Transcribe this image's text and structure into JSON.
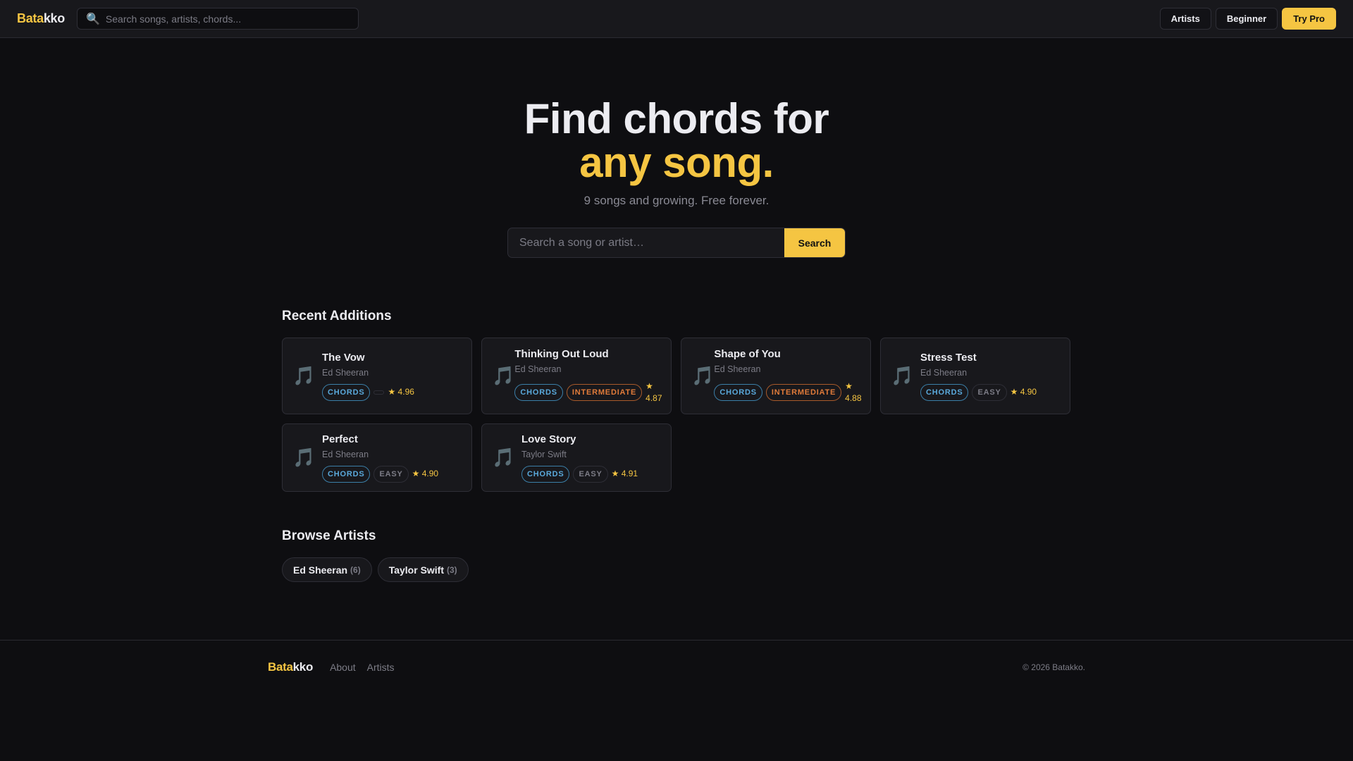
{
  "header": {
    "logo_a": "Bata",
    "logo_b": "kko",
    "search_placeholder": "Search songs, artists, chords...",
    "nav": [
      "Artists",
      "Beginner",
      "Try Pro"
    ]
  },
  "hero": {
    "title_line1": "Find chords for",
    "title_line2": "any song.",
    "subtitle": "9 songs and growing. Free forever.",
    "search_placeholder": "Search a song or artist…",
    "search_button": "Search"
  },
  "recent": {
    "heading": "Recent Additions",
    "cards": [
      {
        "title": "The Vow",
        "artist": "Ed Sheeran",
        "type": "CHORDS",
        "level": "",
        "rating": "★ 4.96"
      },
      {
        "title": "Thinking Out Loud",
        "artist": "Ed Sheeran",
        "type": "CHORDS",
        "level": "INTERMEDIATE",
        "rating": "★ 4.87"
      },
      {
        "title": "Shape of You",
        "artist": "Ed Sheeran",
        "type": "CHORDS",
        "level": "INTERMEDIATE",
        "rating": "★ 4.88"
      },
      {
        "title": "Stress Test",
        "artist": "Ed Sheeran",
        "type": "CHORDS",
        "level": "EASY",
        "rating": "★ 4.90"
      },
      {
        "title": "Perfect",
        "artist": "Ed Sheeran",
        "type": "CHORDS",
        "level": "EASY",
        "rating": "★ 4.90"
      },
      {
        "title": "Love Story",
        "artist": "Taylor Swift",
        "type": "CHORDS",
        "level": "EASY",
        "rating": "★ 4.91"
      }
    ]
  },
  "browse": {
    "heading": "Browse Artists",
    "artists": [
      {
        "name": "Ed Sheeran",
        "count": "(6)"
      },
      {
        "name": "Taylor Swift",
        "count": "(3)"
      }
    ]
  },
  "footer": {
    "logo_a": "Bata",
    "logo_b": "kko",
    "links": [
      "About",
      "Artists"
    ],
    "copyright": "© 2026 Batakko."
  },
  "colors": {
    "accent": "#f5c542",
    "chords": "#5aa9db",
    "intermediate": "#e07b3a"
  }
}
